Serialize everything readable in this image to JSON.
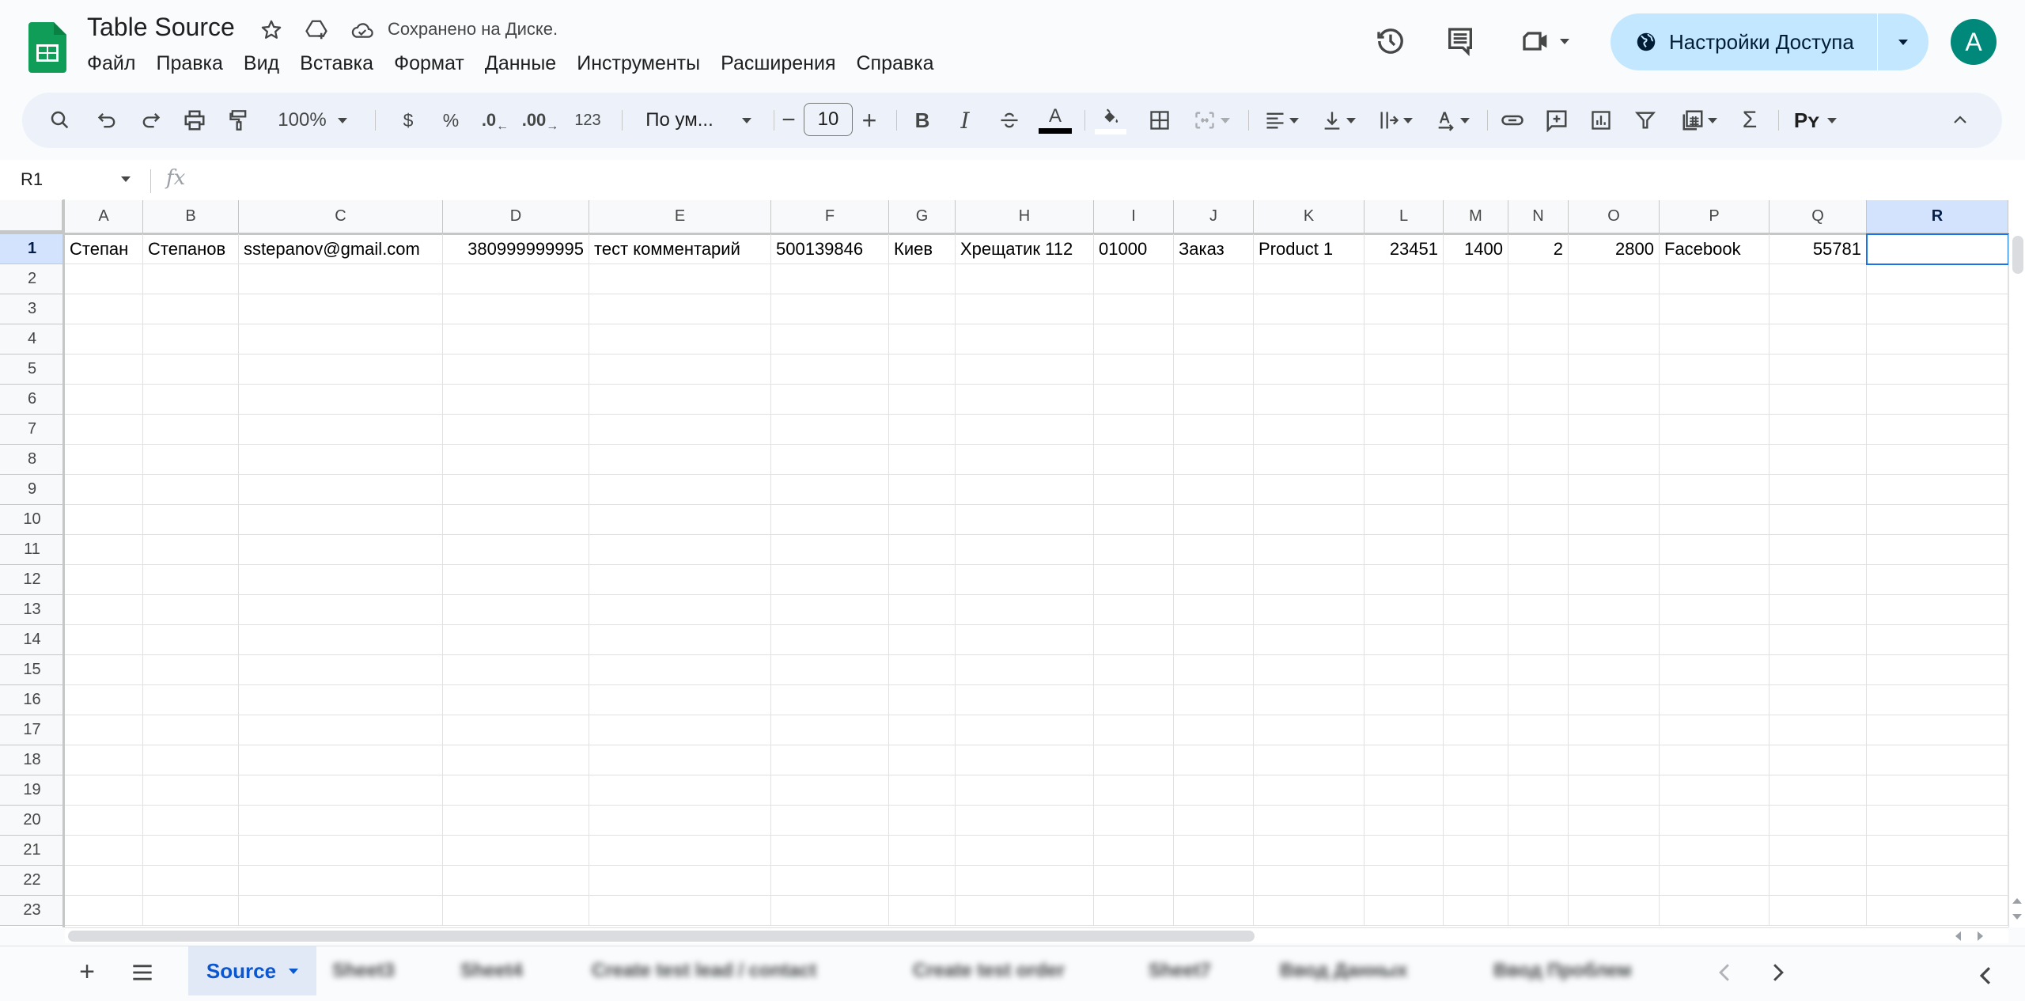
{
  "app": {
    "doc_title": "Table Source",
    "save_status": "Сохранено на Диске.",
    "menu": [
      "Файл",
      "Правка",
      "Вид",
      "Вставка",
      "Формат",
      "Данные",
      "Инструменты",
      "Расширения",
      "Справка"
    ],
    "share_label": "Настройки Доступа",
    "avatar_letter": "A",
    "colors": {
      "share_bg": "#c2e7ff",
      "avatar_bg": "#00897b",
      "selection": "#1a73e8",
      "selected_header": "#d3e3fd",
      "sheets_green": "#0f9d58"
    }
  },
  "toolbar": {
    "zoom": "100%",
    "currency": "$",
    "percent": "%",
    "decrease_decimals": ".0",
    "increase_decimals": ".00",
    "number_format": "123",
    "font": "По ум...",
    "font_size": "10",
    "bold": "B",
    "italic": "I",
    "text_color": "A",
    "sigma": "Σ",
    "input_tools": "Рʏ"
  },
  "formula_bar": {
    "name_box": "R1",
    "fx": "fx",
    "formula": ""
  },
  "sheet": {
    "columns": [
      "A",
      "B",
      "C",
      "D",
      "E",
      "F",
      "G",
      "H",
      "I",
      "J",
      "K",
      "L",
      "M",
      "N",
      "O",
      "P",
      "Q",
      "R"
    ],
    "selected_column": "R",
    "selected_row": 1,
    "selected_cell": "R1",
    "row_numbers": [
      "1",
      "2",
      "3",
      "4",
      "5",
      "6",
      "7",
      "8",
      "9",
      "10",
      "11",
      "12",
      "13",
      "14",
      "15",
      "16",
      "17",
      "18",
      "19",
      "20",
      "21",
      "22",
      "23"
    ],
    "row1": [
      {
        "value": "Степан",
        "num": false
      },
      {
        "value": "Степанов",
        "num": false
      },
      {
        "value": "sstepanov@gmail.com",
        "num": false
      },
      {
        "value": "380999999995",
        "num": true
      },
      {
        "value": "тест комментарий",
        "num": false
      },
      {
        "value": "500139846",
        "num": false
      },
      {
        "value": "Киев",
        "num": false
      },
      {
        "value": "Хрещатик 112",
        "num": false
      },
      {
        "value": "01000",
        "num": false
      },
      {
        "value": "Заказ",
        "num": false
      },
      {
        "value": "Product 1",
        "num": false
      },
      {
        "value": "23451",
        "num": true
      },
      {
        "value": "1400",
        "num": true
      },
      {
        "value": "2",
        "num": true
      },
      {
        "value": "2800",
        "num": true
      },
      {
        "value": "Facebook",
        "num": false
      },
      {
        "value": "55781",
        "num": true
      },
      {
        "value": "",
        "num": false
      }
    ]
  },
  "sheet_tabs": {
    "active": "Source",
    "others": [
      "Sheet3",
      "Sheet4",
      "Create test lead / contact",
      "Create test order",
      "Sheet7",
      "Ввод Данных",
      "Ввод Проблем"
    ]
  }
}
